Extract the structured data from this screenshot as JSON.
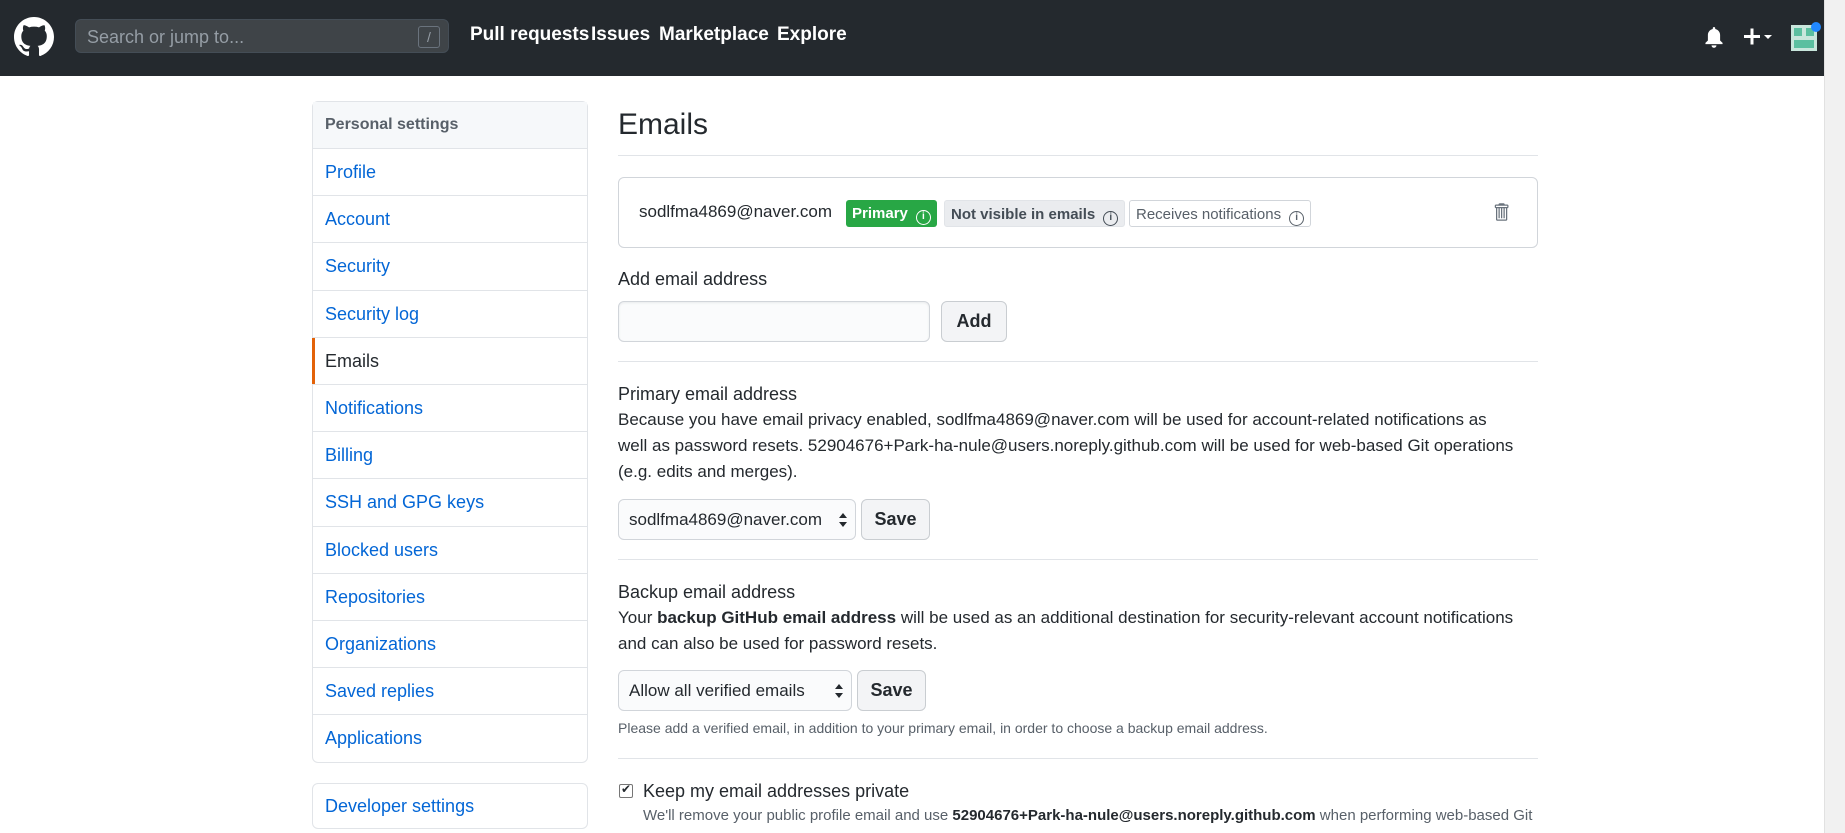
{
  "header": {
    "search_placeholder": "Search or jump to...",
    "search_shortcut": "/",
    "nav": [
      "Pull requests",
      "Issues",
      "Marketplace",
      "Explore"
    ]
  },
  "sidebar": {
    "heading": "Personal settings",
    "items": [
      {
        "label": "Profile"
      },
      {
        "label": "Account"
      },
      {
        "label": "Security"
      },
      {
        "label": "Security log"
      },
      {
        "label": "Emails",
        "active": true
      },
      {
        "label": "Notifications"
      },
      {
        "label": "Billing"
      },
      {
        "label": "SSH and GPG keys"
      },
      {
        "label": "Blocked users"
      },
      {
        "label": "Repositories"
      },
      {
        "label": "Organizations"
      },
      {
        "label": "Saved replies"
      },
      {
        "label": "Applications"
      }
    ],
    "developer_settings": "Developer settings"
  },
  "main": {
    "title": "Emails",
    "email_entry": {
      "address": "sodlfma4869@naver.com",
      "badge_primary": "Primary",
      "badge_private": "Not visible in emails",
      "badge_notify": "Receives notifications"
    },
    "add_email": {
      "label": "Add email address",
      "value": "",
      "button": "Add"
    },
    "primary": {
      "label": "Primary email address",
      "description_line1": "Because you have email privacy enabled, sodlfma4869@naver.com will be used for account-related notifications as",
      "description_line2": "well as password resets. 52904676+Park-ha-nule@users.noreply.github.com will be used for web-based Git operations",
      "description_line3": "(e.g. edits and merges).",
      "select_value": "sodlfma4869@naver.com",
      "save_button": "Save"
    },
    "backup": {
      "label": "Backup email address",
      "desc_prefix": "Your ",
      "desc_bold": "backup GitHub email address",
      "desc_suffix": " will be used as an additional destination for security-relevant account notifications",
      "desc_line2": "and can also be used for password resets.",
      "select_value": "Allow all verified emails",
      "save_button": "Save",
      "note": "Please add a verified email, in addition to your primary email, in order to choose a backup email address."
    },
    "keep_private": {
      "label": "Keep my email addresses private",
      "checked": true,
      "note_prefix": "We'll remove your public profile email and use ",
      "note_bold": "52904676+Park-ha-nule@users.noreply.github.com",
      "note_suffix": " when performing web-based Git"
    }
  },
  "colors": {
    "header_bg": "#24292e",
    "link": "#0366d6",
    "primary_badge": "#28a745",
    "active_marker": "#e36209"
  }
}
